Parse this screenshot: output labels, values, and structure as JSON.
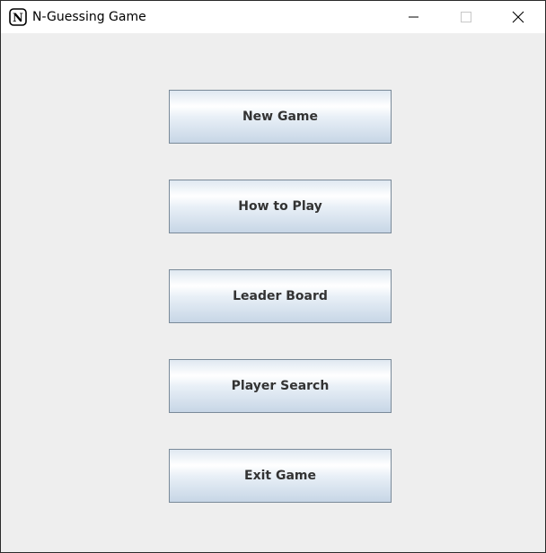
{
  "window": {
    "title": "N-Guessing Game",
    "app_icon_glyph": "N",
    "controls": [
      "minimize-icon",
      "maximize-icon",
      "close-icon"
    ]
  },
  "menu": {
    "buttons": [
      {
        "label": "New Game"
      },
      {
        "label": "How to Play"
      },
      {
        "label": "Leader Board"
      },
      {
        "label": "Player Search"
      },
      {
        "label": "Exit Game"
      }
    ]
  },
  "colors": {
    "background": "#eeeeee",
    "titlebar": "#ffffff",
    "button_border": "#7a8a99",
    "button_text": "#333333"
  }
}
